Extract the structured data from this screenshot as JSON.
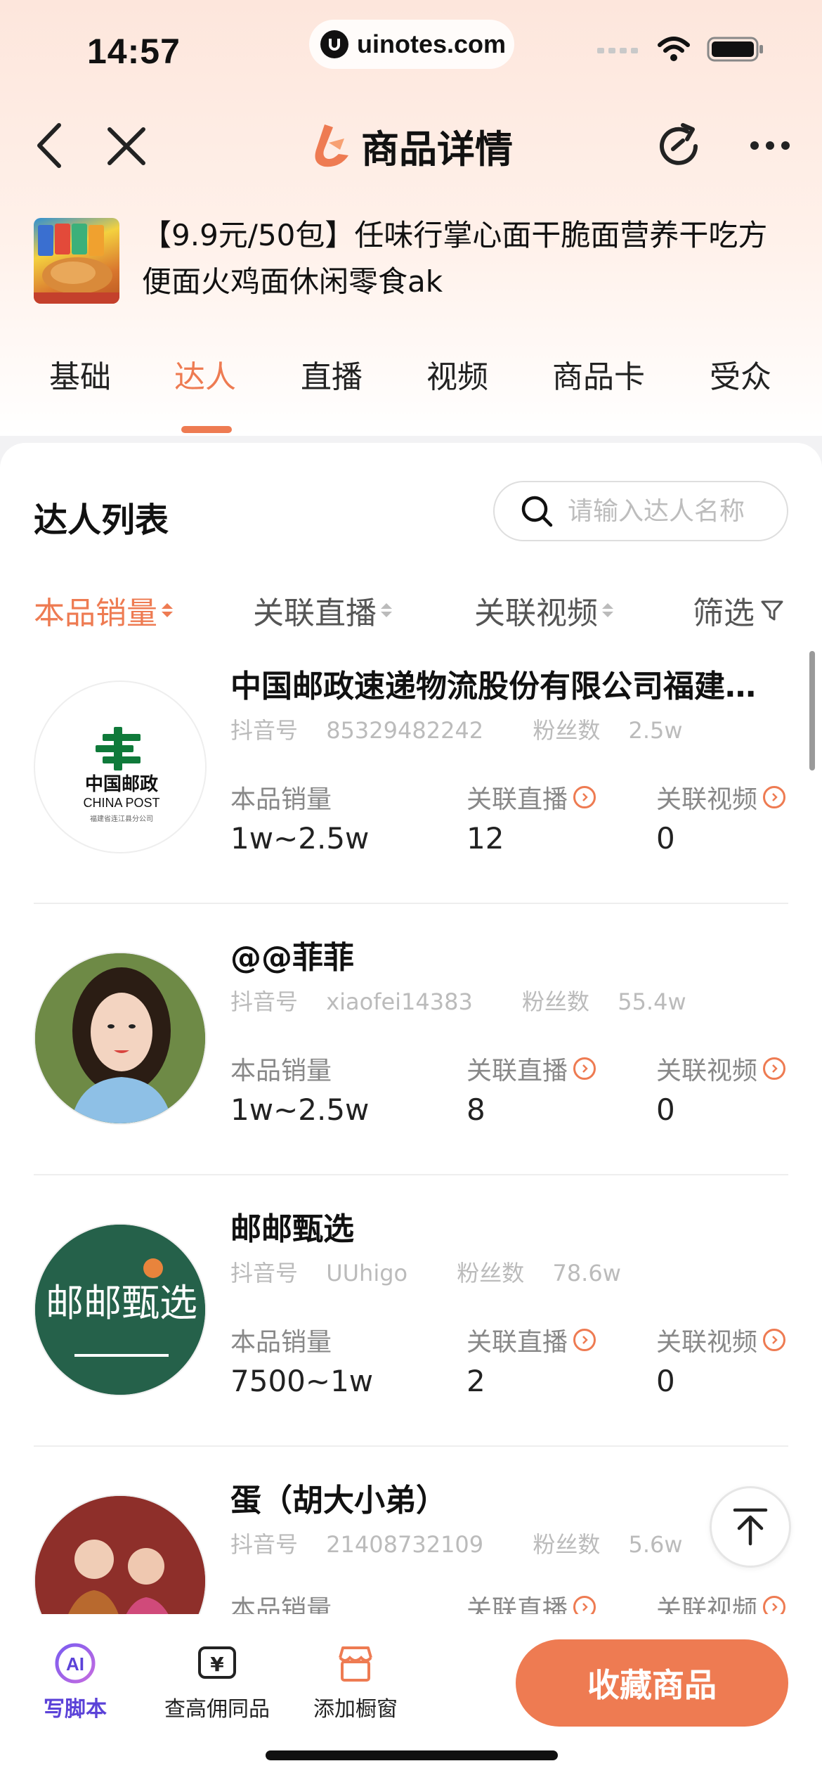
{
  "status_bar": {
    "time": "14:57",
    "url": "uinotes.com"
  },
  "nav": {
    "title": "商品详情"
  },
  "product": {
    "title": "【9.9元/50包】任味行掌心面干脆面营养干吃方便面火鸡面休闲零食ak"
  },
  "tabs": [
    "基础",
    "达人",
    "直播",
    "视频",
    "商品卡",
    "受众"
  ],
  "active_tab": "达人",
  "list": {
    "title": "达人列表",
    "search_placeholder": "请输入达人名称",
    "sort": [
      "本品销量",
      "关联直播",
      "关联视频",
      "筛选"
    ],
    "stat_labels": {
      "sales": "本品销量",
      "live": "关联直播",
      "video": "关联视频"
    },
    "meta_labels": {
      "id": "抖音号",
      "fans": "粉丝数"
    },
    "items": [
      {
        "name": "中国邮政速递物流股份有限公司福建…",
        "douyin_id": "85329482242",
        "fans": "2.5w",
        "sales": "1w~2.5w",
        "live": "12",
        "video": "0",
        "avatar_text_cn": "中国邮政",
        "avatar_text_en": "CHINA POST",
        "avatar_sub": "福建省连江县分公司"
      },
      {
        "name": "@@菲菲",
        "douyin_id": "xiaofei14383",
        "fans": "55.4w",
        "sales": "1w~2.5w",
        "live": "8",
        "video": "0"
      },
      {
        "name": "邮邮甄选",
        "douyin_id": "UUhigo",
        "fans": "78.6w",
        "sales": "7500~1w",
        "live": "2",
        "video": "0",
        "avatar_text": "邮邮甄选"
      },
      {
        "name": "蛋（胡大小弟）",
        "douyin_id": "21408732109",
        "fans": "5.6w",
        "sales": "",
        "live": "",
        "video": ""
      }
    ]
  },
  "bottom_bar": {
    "ai_label": "写脚本",
    "ai_badge": "AI",
    "commission_label": "查高佣同品",
    "commission_icon": "¥",
    "window_label": "添加橱窗",
    "collect_label": "收藏商品"
  },
  "colors": {
    "accent": "#ee7b52",
    "ai": "#5b42d8"
  }
}
